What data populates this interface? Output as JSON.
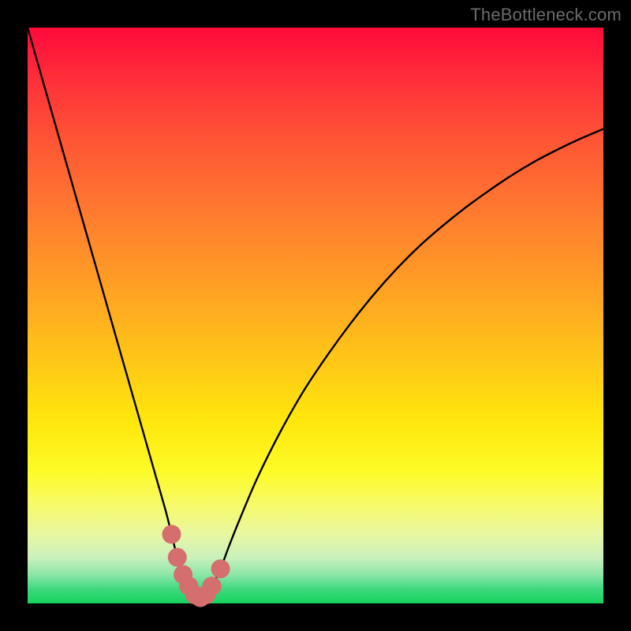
{
  "watermark": {
    "text": "TheBottleneck.com"
  },
  "colors": {
    "frame": "#000000",
    "curve_stroke": "#000000",
    "marker_fill": "#d56e6e",
    "marker_stroke": "#c95f5f"
  },
  "chart_data": {
    "type": "line",
    "title": "",
    "xlabel": "",
    "ylabel": "",
    "xlim": [
      0,
      100
    ],
    "ylim": [
      0,
      100
    ],
    "grid": false,
    "x": [
      0,
      2,
      4,
      6,
      8,
      10,
      12,
      14,
      16,
      18,
      20,
      22,
      24,
      25,
      26,
      27,
      28,
      29,
      30,
      31,
      32,
      33.5,
      35,
      37,
      40,
      44,
      48,
      52,
      56,
      60,
      64,
      68,
      72,
      76,
      80,
      84,
      88,
      92,
      96,
      100
    ],
    "values": [
      100,
      93,
      86,
      79,
      72,
      65,
      58,
      51,
      44,
      37,
      30,
      23,
      16,
      12,
      8,
      5,
      3,
      1.5,
      1,
      1.5,
      3,
      6,
      10,
      15,
      22,
      30,
      37,
      43,
      48.5,
      53.5,
      58,
      62,
      65.5,
      68.7,
      71.6,
      74.3,
      76.7,
      78.8,
      80.7,
      82.4
    ],
    "marker_x": [
      25,
      26,
      27,
      28,
      29,
      30,
      31,
      32,
      33.5
    ],
    "marker_y": [
      12,
      8,
      5,
      3,
      1.5,
      1,
      1.5,
      3,
      6
    ],
    "marker_size": 12
  }
}
